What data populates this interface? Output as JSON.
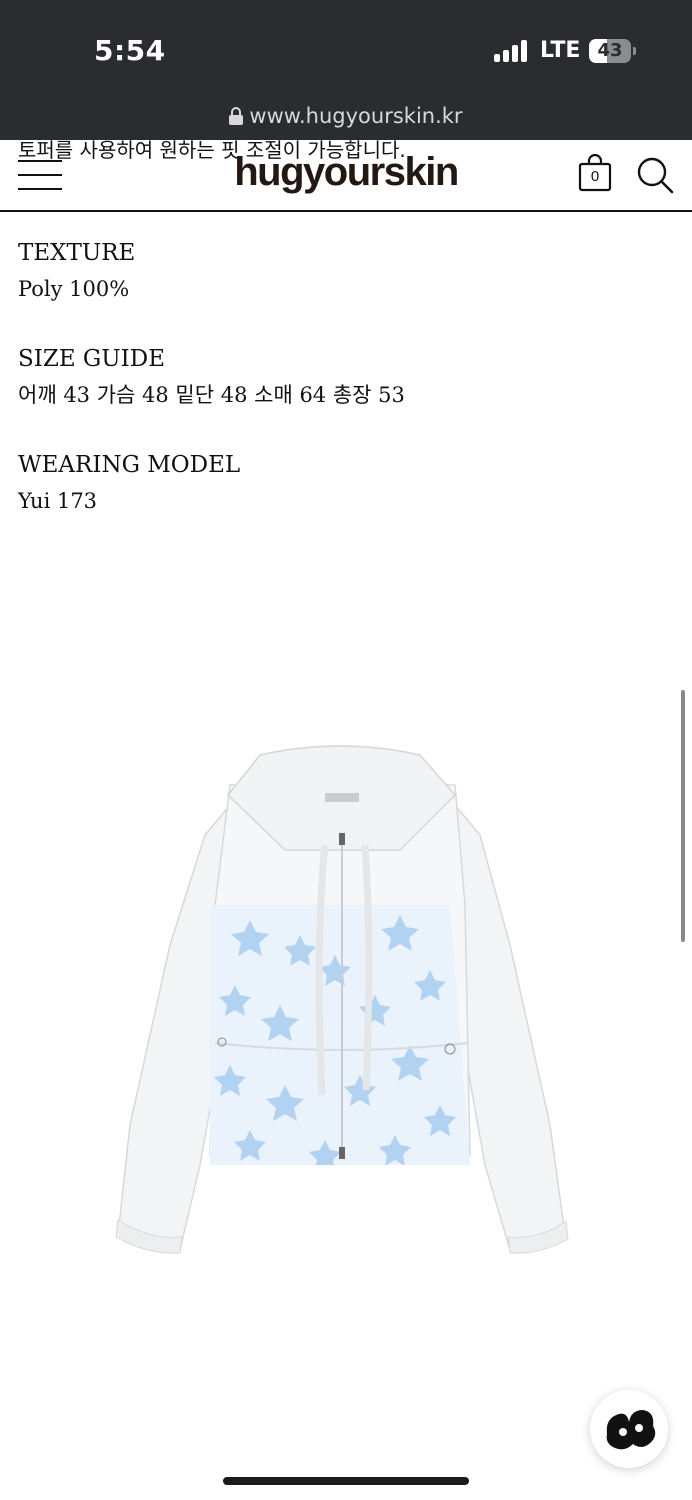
{
  "status_bar": {
    "time": "5:54",
    "network": "LTE",
    "battery": "43",
    "battery_level": 0.43
  },
  "browser": {
    "url": "www.hugyourskin.kr"
  },
  "header": {
    "scrolled_text": "토퍼를 사용하여 원하는 핏 조절이 가능합니다.",
    "logo": "hugyourskin",
    "cart_count": "0",
    "icons": [
      "menu-icon",
      "cart-icon",
      "search-icon"
    ]
  },
  "details": {
    "texture_label": "TEXTURE",
    "texture_value": "Poly 100%",
    "size_label": "SIZE GUIDE",
    "size_value": "어깨 43 가슴 48 밑단 48 소매 64 총장 53",
    "model_label": "WEARING MODEL",
    "model_value": "Yui 173"
  },
  "colors": {
    "status_bg": "#2a2c30",
    "text": "#111111",
    "logo": "#241812",
    "star_print": "#9fc5ea"
  }
}
